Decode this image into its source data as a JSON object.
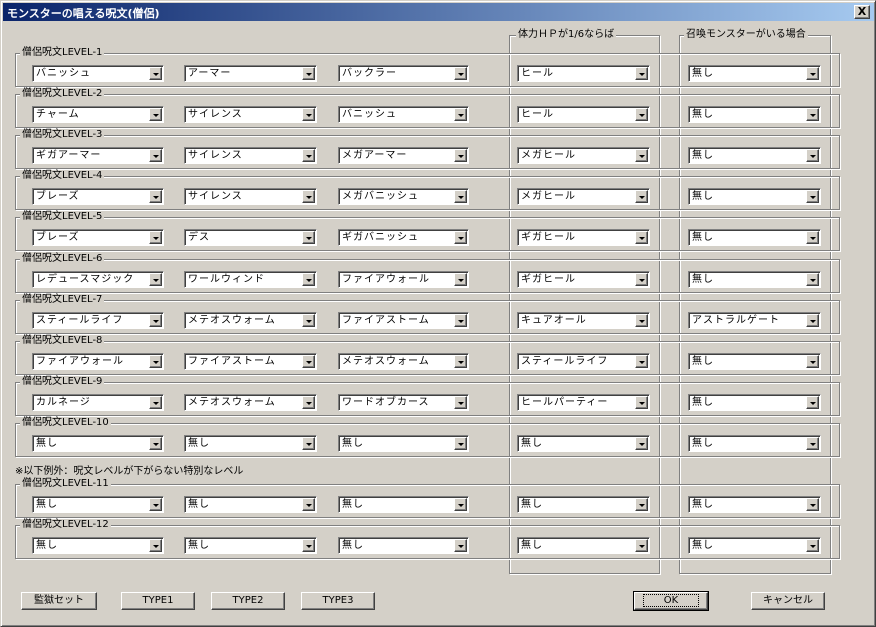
{
  "window": {
    "title": "モンスターの唱える呪文(僧侶)",
    "close_label": "X"
  },
  "column_headers": {
    "hp_header": "体力ＨＰが1/6ならば",
    "summon_header": "召喚モンスターがいる場合"
  },
  "exception_note": "※以下例外：呪文レベルが下がらない特別なレベル",
  "levels": [
    {
      "label": "僧侶呪文LEVEL-1",
      "spell1": "バニッシュ",
      "spell2": "アーマー",
      "spell3": "バックラー",
      "hp": "ヒール",
      "summon": "無し"
    },
    {
      "label": "僧侶呪文LEVEL-2",
      "spell1": "チャーム",
      "spell2": "サイレンス",
      "spell3": "バニッシュ",
      "hp": "ヒール",
      "summon": "無し"
    },
    {
      "label": "僧侶呪文LEVEL-3",
      "spell1": "ギガアーマー",
      "spell2": "サイレンス",
      "spell3": "メガアーマー",
      "hp": "メガヒール",
      "summon": "無し"
    },
    {
      "label": "僧侶呪文LEVEL-4",
      "spell1": "ブレーズ",
      "spell2": "サイレンス",
      "spell3": "メガバニッシュ",
      "hp": "メガヒール",
      "summon": "無し"
    },
    {
      "label": "僧侶呪文LEVEL-5",
      "spell1": "ブレーズ",
      "spell2": "デス",
      "spell3": "ギガバニッシュ",
      "hp": "ギガヒール",
      "summon": "無し"
    },
    {
      "label": "僧侶呪文LEVEL-6",
      "spell1": "レデュースマジック",
      "spell2": "ワールウィンド",
      "spell3": "ファイアウォール",
      "hp": "ギガヒール",
      "summon": "無し"
    },
    {
      "label": "僧侶呪文LEVEL-7",
      "spell1": "スティールライフ",
      "spell2": "メテオスウォーム",
      "spell3": "ファイアストーム",
      "hp": "キュアオール",
      "summon": "アストラルゲート"
    },
    {
      "label": "僧侶呪文LEVEL-8",
      "spell1": "ファイアウォール",
      "spell2": "ファイアストーム",
      "spell3": "メテオスウォーム",
      "hp": "スティールライフ",
      "summon": "無し"
    },
    {
      "label": "僧侶呪文LEVEL-9",
      "spell1": "カルネージ",
      "spell2": "メテオスウォーム",
      "spell3": "ワードオブカース",
      "hp": "ヒールパーティー",
      "summon": "無し"
    },
    {
      "label": "僧侶呪文LEVEL-10",
      "spell1": "無し",
      "spell2": "無し",
      "spell3": "無し",
      "hp": "無し",
      "summon": "無し"
    },
    {
      "label": "僧侶呪文LEVEL-11",
      "spell1": "無し",
      "spell2": "無し",
      "spell3": "無し",
      "hp": "無し",
      "summon": "無し"
    },
    {
      "label": "僧侶呪文LEVEL-12",
      "spell1": "無し",
      "spell2": "無し",
      "spell3": "無し",
      "hp": "無し",
      "summon": "無し"
    }
  ],
  "buttons": {
    "preset": "監獄セット",
    "type1": "TYPE1",
    "type2": "TYPE2",
    "type3": "TYPE3",
    "ok": "OK",
    "cancel": "キャンセル"
  }
}
